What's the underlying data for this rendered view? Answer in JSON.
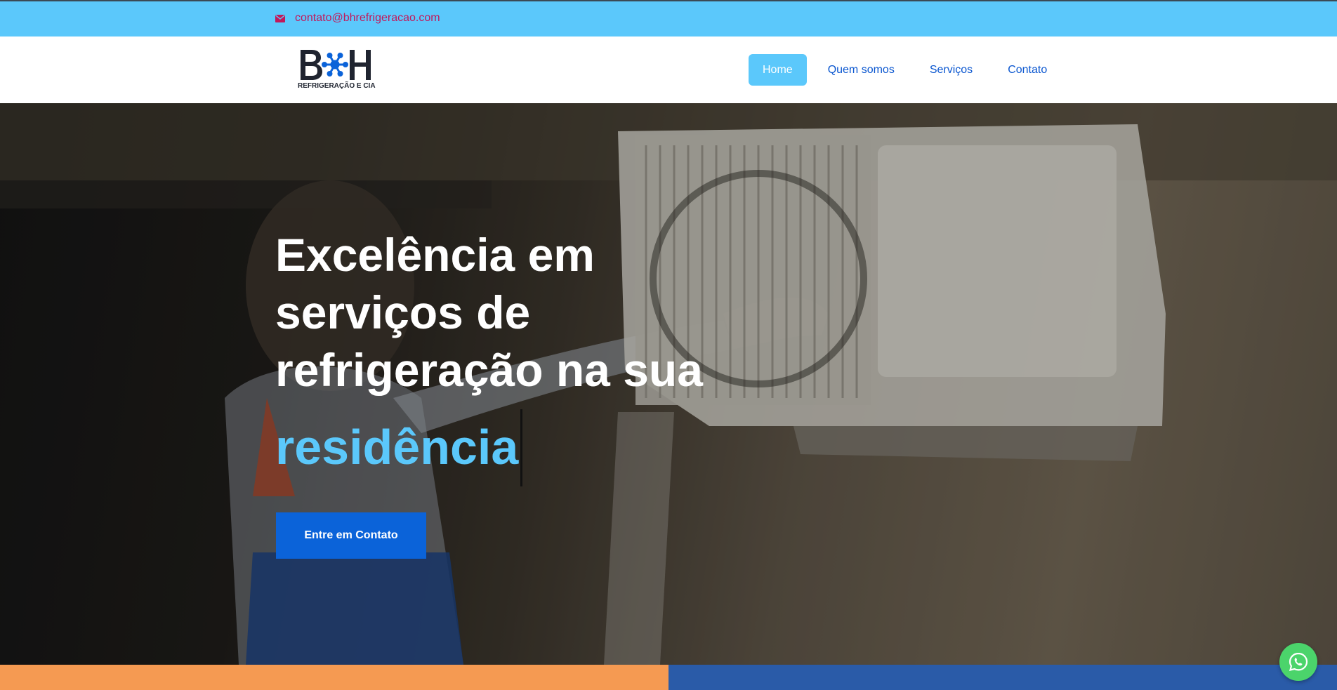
{
  "topbar": {
    "email": "contato@bhrefrigeracao.com",
    "email_icon": "envelope-icon",
    "bg_color": "#5bc8fb"
  },
  "brand": {
    "logo_letters": "B H",
    "subtitle": "REFRIGERAÇÃO E CIA",
    "logo_icon": "snowflake-icon"
  },
  "nav": {
    "items": [
      {
        "label": "Home",
        "active": true
      },
      {
        "label": "Quem somos",
        "active": false
      },
      {
        "label": "Serviços",
        "active": false
      },
      {
        "label": "Contato",
        "active": false
      }
    ]
  },
  "hero": {
    "title": "Excelência em serviços de refrigeração na sua",
    "highlight": "residência",
    "cta_label": "Entre em Contato",
    "highlight_color": "#5bc8fb",
    "cta_color": "#0b63d9"
  },
  "floating": {
    "whatsapp_icon": "whatsapp-icon"
  },
  "colors": {
    "accent": "#5bc8fb",
    "link": "#0b57d0",
    "strip_left": "#f59a52",
    "strip_right": "#2a5ba8"
  }
}
